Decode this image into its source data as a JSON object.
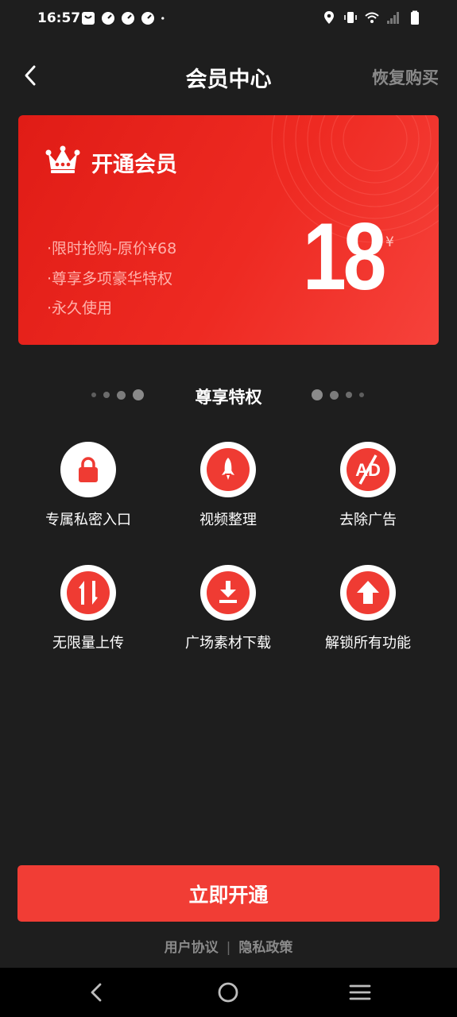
{
  "status_bar": {
    "time": "16:57"
  },
  "header": {
    "title": "会员中心",
    "restore_label": "恢复购买"
  },
  "card": {
    "title": "开通会员",
    "features": [
      "·限时抢购-原价¥68",
      "·尊享多项豪华特权",
      "·永久使用"
    ],
    "price": "18",
    "currency": "¥"
  },
  "privileges": {
    "title": "尊享特权",
    "items": [
      {
        "label": "专属私密入口",
        "icon": "lock-icon"
      },
      {
        "label": "视频整理",
        "icon": "rocket-icon"
      },
      {
        "label": "去除广告",
        "icon": "no-ad-icon"
      },
      {
        "label": "无限量上传",
        "icon": "transfer-arrows-icon"
      },
      {
        "label": "广场素材下载",
        "icon": "download-icon"
      },
      {
        "label": "解锁所有功能",
        "icon": "up-arrow-icon"
      }
    ]
  },
  "cta": {
    "label": "立即开通"
  },
  "legal": {
    "user_agreement": "用户协议",
    "separator": "|",
    "privacy_policy": "隐私政策"
  },
  "colors": {
    "accent": "#f13d35",
    "background": "#1e1e1e",
    "card_start": "#e01c16",
    "card_end": "#f6423b"
  }
}
